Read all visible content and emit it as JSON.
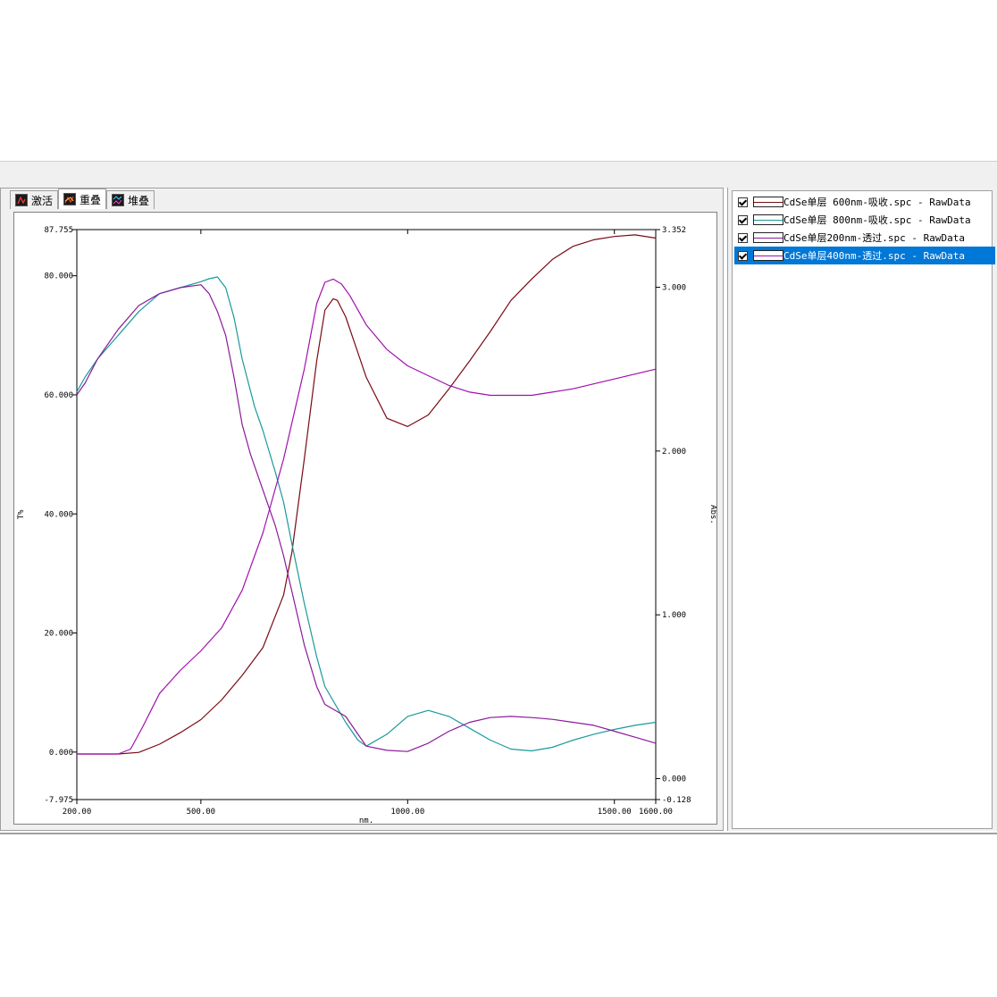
{
  "tabs": [
    {
      "label": "激活",
      "icon": "activate-icon"
    },
    {
      "label": "重叠",
      "icon": "overlay-icon"
    },
    {
      "label": "堆叠",
      "icon": "stack-icon"
    }
  ],
  "legend": [
    {
      "label": "CdSe单层 600nm-吸收.spc - RawData",
      "color": "#7a0a14",
      "checked": true,
      "selected": false
    },
    {
      "label": "CdSe单层 800nm-吸收.spc - RawData",
      "color": "#1a9a9a",
      "checked": true,
      "selected": false
    },
    {
      "label": "CdSe单层200nm-透过.spc - RawData",
      "color": "#8a1a9a",
      "checked": true,
      "selected": false
    },
    {
      "label": "CdSe单层400nm-透过.spc - RawData",
      "color": "#a010b0",
      "checked": true,
      "selected": true
    }
  ],
  "chart_data": {
    "type": "line",
    "xlabel": "nm.",
    "ylabel_left": "T%",
    "ylabel_right": "Abs.",
    "x_ticks": [
      "200.00",
      "500.00",
      "1000.00",
      "1500.00",
      "1600.00"
    ],
    "y_left_ticks": [
      "87.755",
      "80.000",
      "60.000",
      "40.000",
      "20.000",
      "0.000",
      "-7.975"
    ],
    "y_right_ticks": [
      "3.352",
      "3.000",
      "2.000",
      "1.000",
      "0.000",
      "-0.128"
    ],
    "xlim": [
      200,
      1600
    ],
    "ylim_left": [
      -7.975,
      87.755
    ],
    "ylim_right": [
      -0.128,
      3.352
    ],
    "grid": false,
    "series": [
      {
        "axis": "right",
        "color": "#7a0a14",
        "x": [
          200,
          250,
          300,
          350,
          400,
          450,
          500,
          550,
          600,
          650,
          700,
          720,
          750,
          780,
          800,
          820,
          830,
          850,
          900,
          950,
          1000,
          1050,
          1100,
          1150,
          1200,
          1250,
          1300,
          1350,
          1400,
          1450,
          1500,
          1550,
          1600
        ],
        "y": [
          0.15,
          0.15,
          0.15,
          0.16,
          0.21,
          0.28,
          0.36,
          0.48,
          0.63,
          0.8,
          1.12,
          1.38,
          1.95,
          2.55,
          2.86,
          2.93,
          2.92,
          2.82,
          2.45,
          2.2,
          2.15,
          2.22,
          2.38,
          2.55,
          2.73,
          2.92,
          3.05,
          3.17,
          3.25,
          3.29,
          3.31,
          3.32,
          3.3
        ]
      },
      {
        "axis": "left",
        "color": "#1a9a9a",
        "x": [
          200,
          220,
          250,
          300,
          350,
          400,
          450,
          500,
          520,
          540,
          560,
          580,
          600,
          630,
          650,
          680,
          700,
          720,
          750,
          780,
          800,
          850,
          880,
          900,
          950,
          1000,
          1050,
          1100,
          1150,
          1200,
          1250,
          1300,
          1350,
          1400,
          1450,
          1500,
          1550,
          1600
        ],
        "y": [
          60.5,
          63,
          66,
          70,
          74,
          77,
          78,
          79,
          79.5,
          79.8,
          78,
          73,
          66,
          58,
          54,
          47,
          42,
          35,
          25,
          16,
          11,
          5,
          2,
          1,
          3,
          6,
          7,
          6,
          4,
          2,
          0.5,
          0.2,
          0.8,
          2,
          3,
          3.8,
          4.5,
          5
        ]
      },
      {
        "axis": "left",
        "color": "#8a1a9a",
        "x": [
          200,
          220,
          250,
          300,
          350,
          400,
          450,
          500,
          520,
          540,
          560,
          580,
          600,
          620,
          650,
          680,
          700,
          720,
          750,
          780,
          800,
          850,
          880,
          900,
          950,
          1000,
          1050,
          1100,
          1150,
          1200,
          1250,
          1300,
          1350,
          1400,
          1450,
          1500,
          1550,
          1600
        ],
        "y": [
          60,
          62,
          66,
          71,
          75,
          77,
          78,
          78.5,
          77,
          74,
          70,
          63,
          55,
          50,
          44,
          38,
          33,
          27,
          18,
          11,
          8,
          6,
          3,
          1,
          0.3,
          0.1,
          1.5,
          3.5,
          5,
          5.8,
          6,
          5.8,
          5.5,
          5,
          4.5,
          3.5,
          2.5,
          1.5
        ]
      },
      {
        "axis": "right",
        "color": "#a010b0",
        "x": [
          200,
          250,
          300,
          330,
          360,
          400,
          450,
          500,
          550,
          600,
          650,
          700,
          750,
          780,
          800,
          820,
          840,
          860,
          900,
          950,
          1000,
          1050,
          1100,
          1150,
          1200,
          1250,
          1300,
          1350,
          1400,
          1450,
          1500,
          1550,
          1600
        ],
        "y": [
          0.15,
          0.15,
          0.15,
          0.18,
          0.32,
          0.52,
          0.66,
          0.78,
          0.92,
          1.15,
          1.5,
          1.95,
          2.5,
          2.9,
          3.03,
          3.05,
          3.02,
          2.95,
          2.77,
          2.62,
          2.52,
          2.46,
          2.4,
          2.36,
          2.34,
          2.34,
          2.34,
          2.36,
          2.38,
          2.41,
          2.44,
          2.47,
          2.5
        ]
      }
    ]
  }
}
